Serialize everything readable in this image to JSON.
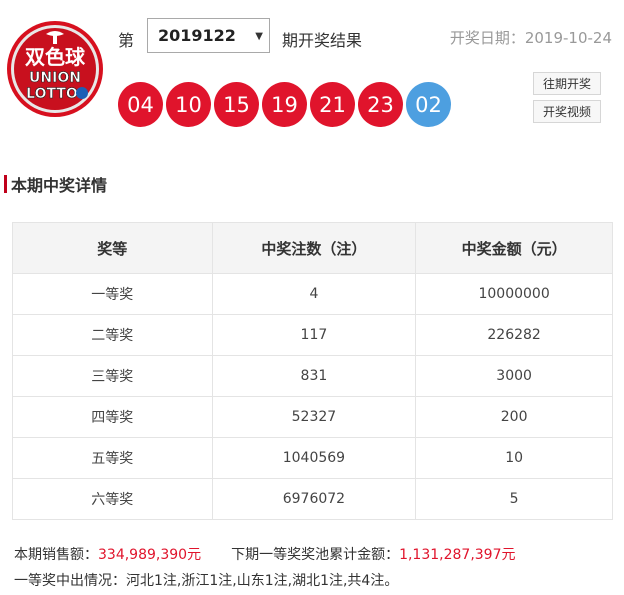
{
  "logo": {
    "text_top": "双色球",
    "text_mid": "UNION",
    "text_bottom": "LOTTO",
    "colors": {
      "outer": "#d7101f",
      "inner": "#c8101e",
      "text": "#ffffff"
    }
  },
  "header": {
    "issue_prefix": "第",
    "issue_selected": "2019122",
    "issue_suffix": "期开奖结果",
    "draw_date": "开奖日期：2019-10-24"
  },
  "balls": {
    "red": [
      "04",
      "10",
      "15",
      "19",
      "21",
      "23"
    ],
    "blue": [
      "02"
    ],
    "colors": {
      "red": "#e0142c",
      "blue": "#4d9fe0"
    }
  },
  "buttons": {
    "past_draws": "往期开奖",
    "draw_video": "开奖视频"
  },
  "section": {
    "title": "本期中奖详情"
  },
  "table": {
    "headers": [
      "奖等",
      "中奖注数（注）",
      "中奖金额（元）"
    ],
    "rows": [
      [
        "一等奖",
        "4",
        "10000000"
      ],
      [
        "二等奖",
        "117",
        "226282"
      ],
      [
        "三等奖",
        "831",
        "3000"
      ],
      [
        "四等奖",
        "52327",
        "200"
      ],
      [
        "五等奖",
        "1040569",
        "10"
      ],
      [
        "六等奖",
        "6976072",
        "5"
      ]
    ]
  },
  "summary": {
    "sales_label": "本期销售额：",
    "sales_value": "334,989,390元",
    "pool_label": "下期一等奖奖池累计金额：",
    "pool_value": "1,131,287,397元",
    "winners_text": "一等奖中出情况：河北1注,浙江1注,山东1注,湖北1注,共4注。"
  }
}
